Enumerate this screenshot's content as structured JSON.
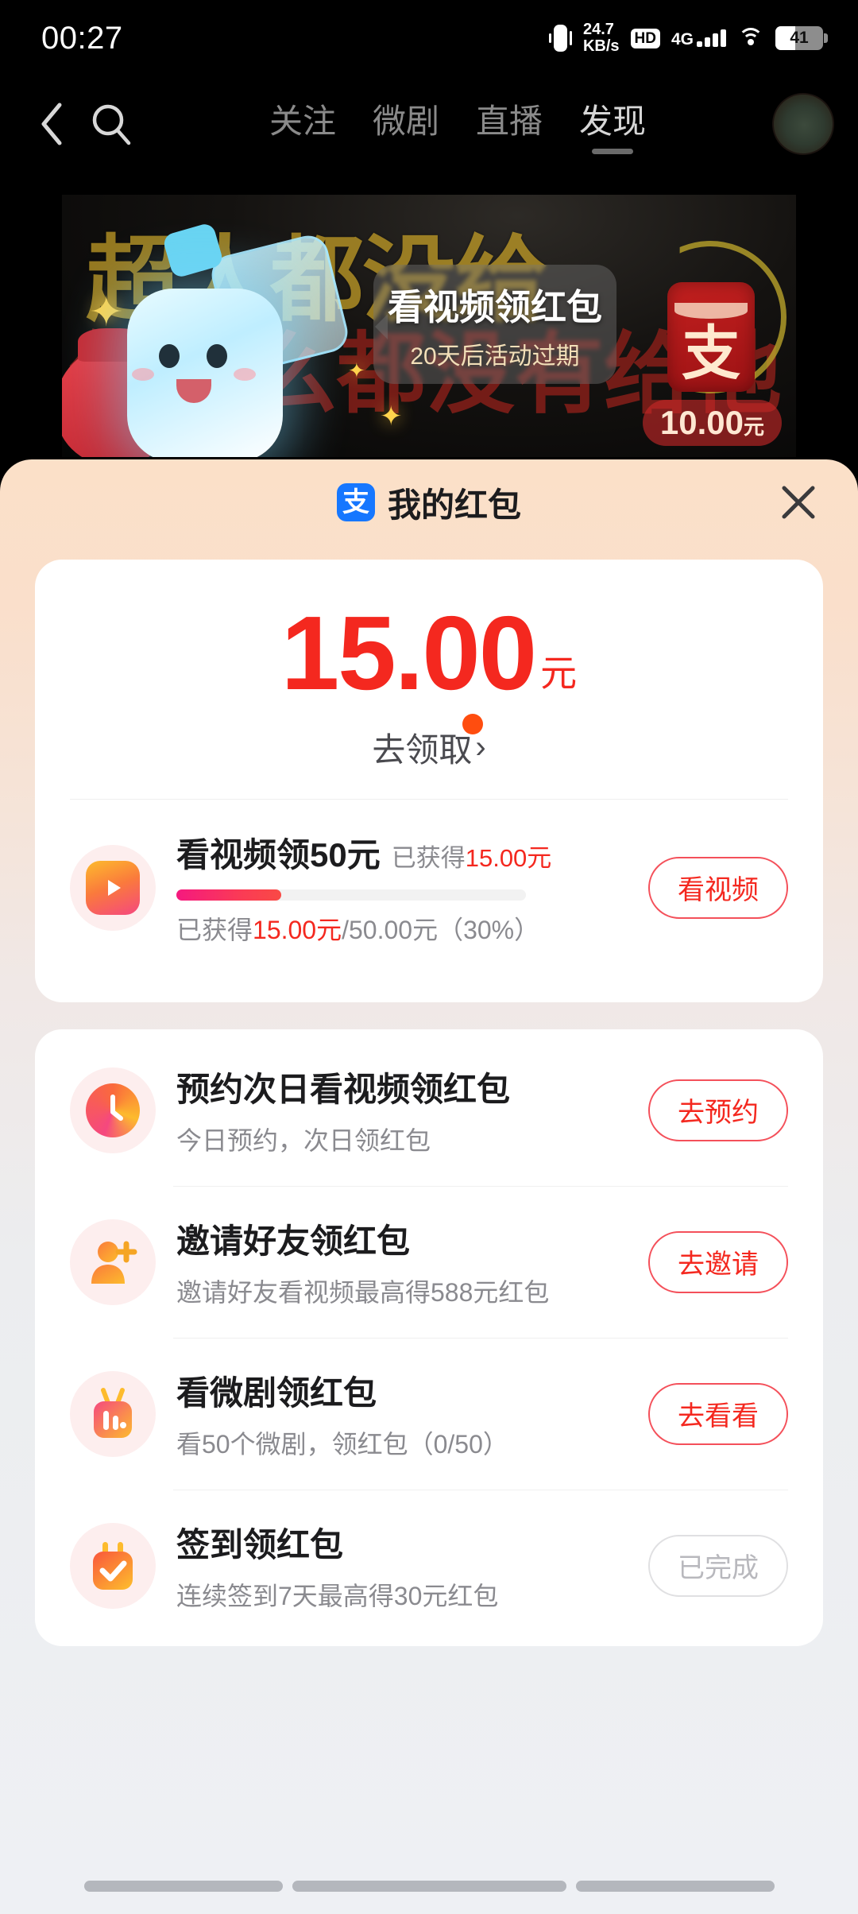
{
  "status_bar": {
    "clock": "00:27",
    "net_speed_value": "24.7",
    "net_speed_unit": "KB/s",
    "hd_badge": "HD",
    "network_gen": "4G",
    "battery_percent": "41",
    "signal_bars": 4,
    "icons": [
      "vibrate-icon",
      "hd-icon",
      "signal-icon",
      "wifi-icon",
      "battery-icon"
    ]
  },
  "top_nav": {
    "back_icon": "chevron-left-icon",
    "search_icon": "search-icon",
    "tabs": [
      {
        "label": "关注",
        "active": false
      },
      {
        "label": "微剧",
        "active": false
      },
      {
        "label": "直播",
        "active": false
      },
      {
        "label": "发现",
        "active": true
      }
    ],
    "avatar": "avatar"
  },
  "banner": {
    "background_text_1": "超人都没给",
    "background_text_2": "你什么都没有给他",
    "tip_title": "看视频领红包",
    "tip_subtitle": "20天后活动过期",
    "envelope_glyph": "支",
    "envelope_amount": "10.00",
    "envelope_amount_unit": "元"
  },
  "sheet": {
    "logo_glyph": "支",
    "title": "我的红包",
    "close_icon": "close-icon",
    "balance": {
      "amount": "15.00",
      "unit": "元",
      "cta_label": "去领取",
      "cta_chevron": "›",
      "badge_dot_color": "#ff4d0f",
      "amount_color": "#f4281f"
    },
    "featured_task": {
      "icon": "play-video-icon",
      "title": "看视频领50元",
      "gained_prefix": "已获得",
      "gained_value": "15.00元",
      "progress_percent": 30,
      "progress_text_prefix": "已获得",
      "progress_text_value": "15.00元",
      "progress_text_suffix": "/50.00元（30%）",
      "button_label": "看视频",
      "button_state": "active"
    },
    "tasks": [
      {
        "icon": "clock-icon",
        "title": "预约次日看视频领红包",
        "subtitle": "今日预约，次日领红包",
        "button_label": "去预约",
        "button_state": "active"
      },
      {
        "icon": "person-add-icon",
        "title": "邀请好友领红包",
        "subtitle": "邀请好友看视频最高得588元红包",
        "button_label": "去邀请",
        "button_state": "active"
      },
      {
        "icon": "tv-icon",
        "title": "看微剧领红包",
        "subtitle": "看50个微剧，领红包（0/50）",
        "button_label": "去看看",
        "button_state": "active"
      },
      {
        "icon": "calendar-check-icon",
        "title": "签到领红包",
        "subtitle": "连续签到7天最高得30元红包",
        "button_label": "已完成",
        "button_state": "done"
      }
    ]
  },
  "theme": {
    "brand_blue": "#1677ff",
    "accent_red": "#f4281f",
    "button_border_red": "#f4505a",
    "progress_start": "#f5197f",
    "progress_end": "#f94a45",
    "icon_gradient_start": "#fdbb2d",
    "icon_gradient_end": "#f5487f",
    "muted_text": "#8a8a8f",
    "disabled_text": "#b8b8bd"
  },
  "nav_bar": {
    "segments": 3
  }
}
